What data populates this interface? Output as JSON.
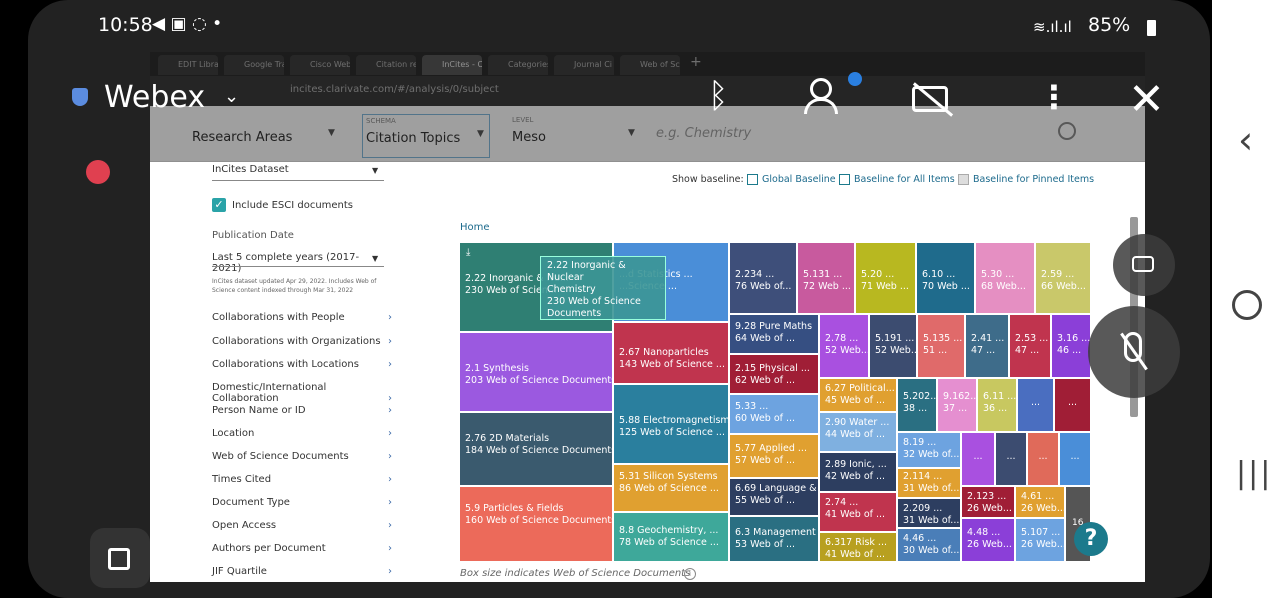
{
  "status": {
    "time": "10:58",
    "battery": "85%"
  },
  "webex": {
    "title": "Webex",
    "chevron": "chevron-down"
  },
  "browser": {
    "tabs": [
      "EDIT Librar",
      "Google Tra",
      "Cisco Webe",
      "Citation rep",
      "InCites - Ci",
      "Categories",
      "Journal Ci",
      "Web of Sci"
    ],
    "url": "incites.clarivate.com/#/analysis/0/subject"
  },
  "filters": {
    "research_areas": "Research Areas",
    "schema_label": "SCHEMA",
    "schema_value": "Citation Topics",
    "level_label": "LEVEL",
    "level_value": "Meso",
    "search_placeholder": "e.g. Chemistry"
  },
  "sidebar": {
    "dataset": "InCites Dataset",
    "esci_label": "Include ESCI documents",
    "pub_date_label": "Publication Date",
    "pub_date_value": "Last 5 complete years (2017-2021)",
    "update_note_1": "InCites dataset updated Apr 29, 2022. Includes Web of",
    "update_note_2": "Science content indexed through Mar 31, 2022",
    "items": [
      "Collaborations with People",
      "Collaborations with Organizations",
      "Collaborations with Locations",
      "Domestic/International Collaboration",
      "Person Name or ID",
      "Location",
      "Web of Science Documents",
      "Times Cited",
      "Document Type",
      "Open Access",
      "Authors per Document",
      "JIF Quartile"
    ]
  },
  "main": {
    "show_baseline": "Show baseline:",
    "global_baseline": "Global Baseline",
    "all_items_baseline": "Baseline for All Items",
    "pinned_baseline": "Baseline for Pinned Items",
    "home": "Home",
    "footnote": "Box size indicates Web of Science Documents",
    "tooltip_1": "2.22 Inorganic & Nuclear",
    "tooltip_2": "Chemistry",
    "tooltip_3": "230 Web of Science",
    "tooltip_4": "Documents",
    "badge": "16"
  },
  "tiles": [
    {
      "l1": "2.22 Inorganic & Nu...",
      "l2": "230 Web of Scien...",
      "color": "#2f7f73"
    },
    {
      "l1": "...d Statistics ...",
      "l2": "...Science ...",
      "color": "#4a8ed8"
    },
    {
      "l1": "2.234 ...",
      "l2": "76 Web of...",
      "color": "#3e4f7a"
    },
    {
      "l1": "5.131 ...",
      "l2": "72 Web ...",
      "color": "#c85a9e"
    },
    {
      "l1": "5.20 ...",
      "l2": "71 Web ...",
      "color": "#b8b820"
    },
    {
      "l1": "6.10 ...",
      "l2": "70 Web ...",
      "color": "#1f6b8c"
    },
    {
      "l1": "5.30 ...",
      "l2": "68 Web...",
      "color": "#e58fc2"
    },
    {
      "l1": "2.59 ...",
      "l2": "66 Web...",
      "color": "#c9c86a"
    },
    {
      "l1": "2.1 Synthesis",
      "l2": "203 Web of Science Documents",
      "color": "#9b59e0"
    },
    {
      "l1": "2.67 Nanoparticles",
      "l2": "143 Web of Science ...",
      "color": "#c0344e"
    },
    {
      "l1": "9.28 Pure Maths",
      "l2": "64 Web of ...",
      "color": "#364f82"
    },
    {
      "l1": "2.15 Physical ...",
      "l2": "62 Web of ...",
      "color": "#a01e36"
    },
    {
      "l1": "2.78 ...",
      "l2": "52 Web...",
      "color": "#a950e0"
    },
    {
      "l1": "5.191 ...",
      "l2": "52 Web...",
      "color": "#3c4c70"
    },
    {
      "l1": "5.135 ...",
      "l2": "51 ...",
      "color": "#e06a6a"
    },
    {
      "l1": "2.41 ...",
      "l2": "47 ...",
      "color": "#3e6c8a"
    },
    {
      "l1": "2.53 ...",
      "l2": "47 ...",
      "color": "#c0344e"
    },
    {
      "l1": "3.16 ...",
      "l2": "46 ...",
      "color": "#8b3fd8"
    },
    {
      "l1": "2.76 2D Materials",
      "l2": "184 Web of Science Documents",
      "color": "#3a5a6e"
    },
    {
      "l1": "5.88 Electromagnetism",
      "l2": "125 Web of Science ...",
      "color": "#2a7f9e"
    },
    {
      "l1": "5.33 ...",
      "l2": "60 Web of ...",
      "color": "#6da3e0"
    },
    {
      "l1": "6.27 Political...",
      "l2": "45 Web of ...",
      "color": "#e0a030"
    },
    {
      "l1": "5.202...",
      "l2": "38 ...",
      "color": "#2a6f82"
    },
    {
      "l1": "9.162...",
      "l2": "37 ...",
      "color": "#e58fd0"
    },
    {
      "l1": "6.11 ...",
      "l2": "36 ...",
      "color": "#c8c860"
    },
    {
      "l1": "...",
      "l2": "",
      "color": "#4a6ec0"
    },
    {
      "l1": "...",
      "l2": "",
      "color": "#a01e36"
    },
    {
      "l1": "2.90 Water ...",
      "l2": "44 Web of ...",
      "color": "#7fb0e0"
    },
    {
      "l1": "5.77 Applied ...",
      "l2": "57 Web of ...",
      "color": "#e0a030"
    },
    {
      "l1": "2.89 Ionic, ...",
      "l2": "42 Web of ...",
      "color": "#2d3e60"
    },
    {
      "l1": "8.19 ...",
      "l2": "32 Web of...",
      "color": "#6da3e0"
    },
    {
      "l1": "...",
      "l2": "",
      "color": "#a950e0"
    },
    {
      "l1": "...",
      "l2": "",
      "color": "#3c4c70"
    },
    {
      "l1": "...",
      "l2": "",
      "color": "#e06a5a"
    },
    {
      "l1": "...",
      "l2": "",
      "color": "#4a8ed8"
    },
    {
      "l1": "5.9 Particles & Fields",
      "l2": "160 Web of Science Documents",
      "color": "#ec6a5a"
    },
    {
      "l1": "5.31 Silicon Systems",
      "l2": "86 Web of Science ...",
      "color": "#e0a030"
    },
    {
      "l1": "6.69 Language & ...",
      "l2": "55 Web of ...",
      "color": "#2d3e60"
    },
    {
      "l1": "2.74 ...",
      "l2": "41 Web of ...",
      "color": "#c0344e"
    },
    {
      "l1": "2.114 ...",
      "l2": "31 Web of...",
      "color": "#e0a030"
    },
    {
      "l1": "2.209 ...",
      "l2": "31 Web of...",
      "color": "#2d3e60"
    },
    {
      "l1": "2.123 ...",
      "l2": "26 Web...",
      "color": "#a01e36"
    },
    {
      "l1": "4.61 ...",
      "l2": "26 Web...",
      "color": "#e0a030"
    },
    {
      "l1": "8.8 Geochemistry, ...",
      "l2": "78 Web of Science ...",
      "color": "#3ea89a"
    },
    {
      "l1": "6.3 Management",
      "l2": "53 Web of ...",
      "color": "#2a6f82"
    },
    {
      "l1": "6.317 Risk ...",
      "l2": "41 Web of ...",
      "color": "#b8a020"
    },
    {
      "l1": "4.46 ...",
      "l2": "30 Web of...",
      "color": "#4a7eb8"
    },
    {
      "l1": "4.48 ...",
      "l2": "26 Web...",
      "color": "#8b3fd8"
    },
    {
      "l1": "5.107 ...",
      "l2": "26 Web...",
      "color": "#6da3e0"
    }
  ]
}
